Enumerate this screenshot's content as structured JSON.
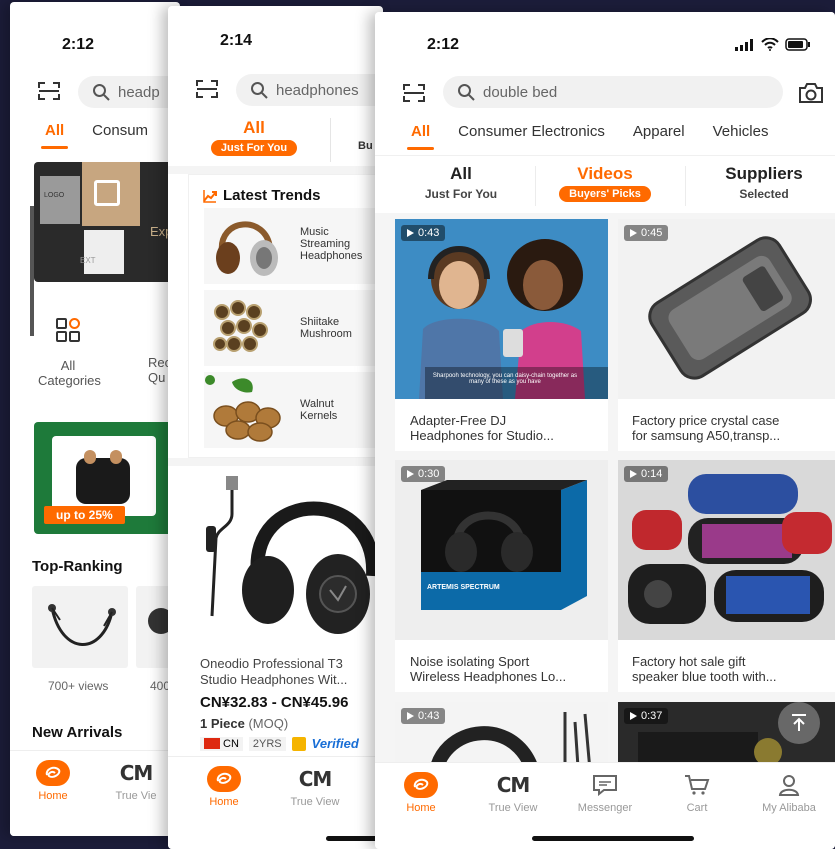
{
  "screen1": {
    "time": "2:12",
    "search_text": "headp",
    "tabs": [
      "All",
      "Consum"
    ],
    "banner_text": "Exp",
    "categories": [
      {
        "label": "All\nCategories"
      },
      {
        "label": "Rec\nQu"
      }
    ],
    "promo_badge": "up to 25%",
    "top_ranking_title": "Top-Ranking",
    "views": [
      "700+ views",
      "400"
    ],
    "new_arrivals_title": "New Arrivals",
    "nav": [
      {
        "label": "Home"
      },
      {
        "label": "True Vie"
      }
    ]
  },
  "screen2": {
    "time": "2:14",
    "search_text": "headphones",
    "tab_main": "All",
    "tab_main_sub": "Just For You",
    "tab_next_sub": "Bu",
    "trends_title": "Latest Trends",
    "trends": [
      {
        "label": "Music\nStreaming\nHeadphones"
      },
      {
        "label": "Shiitake\nMushroom"
      },
      {
        "label": "Walnut\nKernels"
      }
    ],
    "product_title": "Oneodio Professional T3\nStudio Headphones Wit...",
    "price": "CN¥32.83 - CN¥45.96",
    "moq": "1 Piece",
    "moq_unit": "(MOQ)",
    "country": "CN",
    "years": "2YRS",
    "verified": "Verified",
    "nav": [
      {
        "label": "Home"
      },
      {
        "label": "True View"
      }
    ]
  },
  "screen3": {
    "time": "2:12",
    "search_text": "double bed",
    "tabs": [
      "All",
      "Consumer Electronics",
      "Apparel",
      "Vehicles"
    ],
    "subtabs": [
      {
        "title": "All",
        "sub": "Just For You"
      },
      {
        "title": "Videos",
        "sub": "Buyers' Picks"
      },
      {
        "title": "Suppliers",
        "sub": "Selected"
      }
    ],
    "video_caption": "Sharpooh technology, you can daisy-chain together as many of these as you have",
    "videos": [
      {
        "duration": "0:43",
        "title": "Adapter-Free DJ\nHeadphones for Studio..."
      },
      {
        "duration": "0:45",
        "title": "Factory price crystal case\nfor samsung A50,transp..."
      },
      {
        "duration": "0:30",
        "title": "Noise isolating Sport\nWireless Headphones Lo..."
      },
      {
        "duration": "0:14",
        "title": "Factory hot sale gift\nspeaker blue tooth with..."
      },
      {
        "duration": "0:43",
        "title": ""
      },
      {
        "duration": "0:37",
        "title": ""
      }
    ],
    "box_text": "ARTEMIS SPECTRUM",
    "nav": [
      {
        "label": "Home"
      },
      {
        "label": "True View"
      },
      {
        "label": "Messenger"
      },
      {
        "label": "Cart"
      },
      {
        "label": "My Alibaba"
      }
    ]
  },
  "colors": {
    "accent": "#ff6a00",
    "backdrop": "#1c1d3a"
  }
}
